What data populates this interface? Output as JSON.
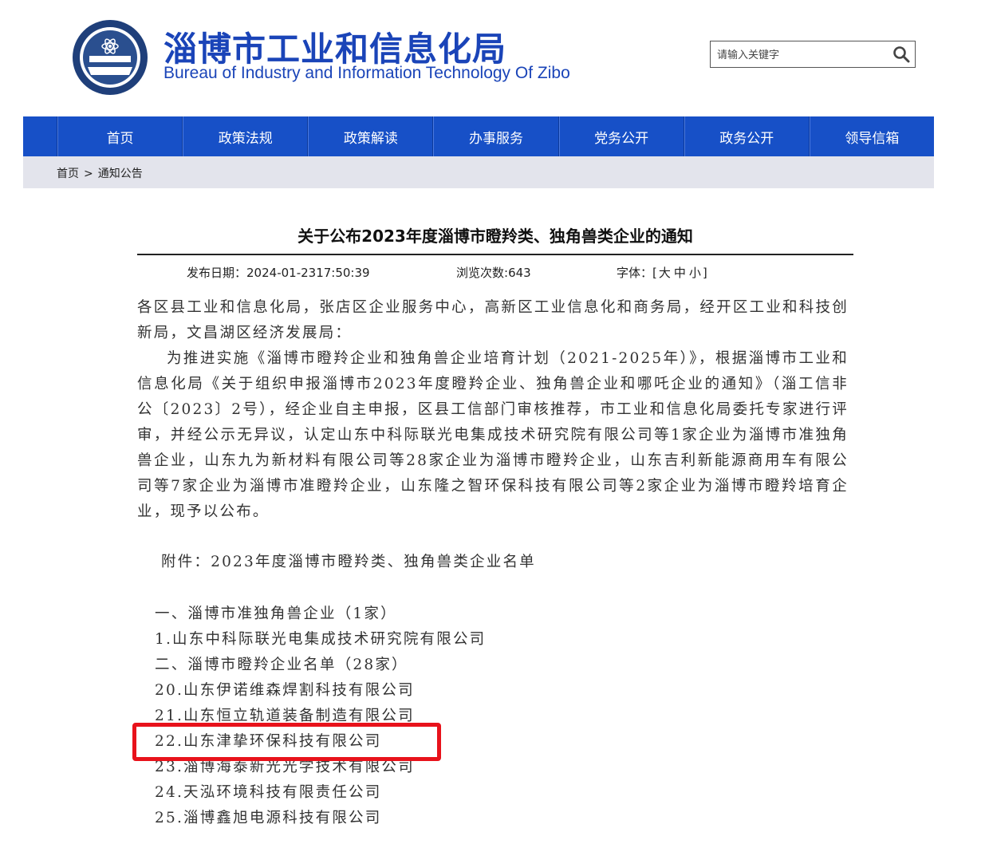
{
  "header": {
    "title_cn": "淄博市工业和信息化局",
    "title_en": "Bureau of Industry and Information Technology Of Zibo",
    "search_placeholder": "请输入关键字"
  },
  "nav": {
    "items": [
      "首页",
      "政策法规",
      "政策解读",
      "办事服务",
      "党务公开",
      "政务公开",
      "领导信箱"
    ]
  },
  "breadcrumb": {
    "home": "首页",
    "separator": ">",
    "current": "通知公告"
  },
  "article": {
    "title": "关于公布2023年度淄博市瞪羚类、独角兽类企业的通知",
    "date_label": "发布日期：",
    "date": "2024-01-2317:50:39",
    "views_label": "浏览次数:",
    "views": "643",
    "font_label": "字体：[",
    "font_large": "大",
    "font_medium": "中",
    "font_small": "小",
    "font_close": "]",
    "paragraph1": "各区县工业和信息化局，张店区企业服务中心，高新区工业信息化和商务局，经开区工业和科技创新局，文昌湖区经济发展局：",
    "paragraph2": "为推进实施《淄博市瞪羚企业和独角兽企业培育计划（2021-2025年）》，根据淄博市工业和信息化局《关于组织申报淄博市2023年度瞪羚企业、独角兽企业和哪吒企业的通知》（淄工信非公〔2023〕2号），经企业自主申报，区县工信部门审核推荐，市工业和信息化局委托专家进行评审，并经公示无异议，认定山东中科际联光电集成技术研究院有限公司等1家企业为淄博市准独角兽企业，山东九为新材料有限公司等28家企业为淄博市瞪羚企业，山东吉利新能源商用车有限公司等7家企业为淄博市准瞪羚企业，山东隆之智环保科技有限公司等2家企业为淄博市瞪羚培育企业，现予以公布。",
    "attachment": "附件：2023年度淄博市瞪羚类、独角兽类企业名单",
    "list": [
      "一、淄博市准独角兽企业（1家）",
      "1.山东中科际联光电集成技术研究院有限公司",
      "二、淄博市瞪羚企业名单（28家）",
      "20.山东伊诺维森焊割科技有限公司",
      "21.山东恒立轨道装备制造有限公司",
      "22.山东津挚环保科技有限公司",
      "23.淄博海泰新光光学技术有限公司",
      "24.天泓环境科技有限责任公司",
      "25.淄博鑫旭电源科技有限公司"
    ]
  },
  "colors": {
    "brand_blue": "#1a44b8",
    "nav_blue": "#1750c7",
    "highlight_red": "#e8121b"
  }
}
